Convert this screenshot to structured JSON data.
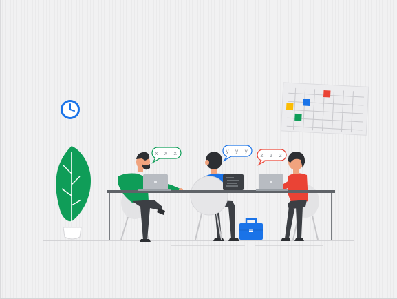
{
  "scene": {
    "description_label": "",
    "palette": {
      "background": "#efeff0",
      "table": "#5f6368",
      "green": "#0f9d58",
      "blue": "#1a73e8",
      "red": "#ea4335",
      "yellow": "#fbbc04",
      "chair": "#e6e6e8",
      "laptop": "#b8bcc2",
      "skin": "#f0a37e"
    },
    "icons": [
      "wall-clock-icon",
      "calendar-board",
      "potted-plant",
      "briefcase-icon"
    ],
    "speech_bubbles": [
      {
        "id": "left",
        "text": "x x x",
        "color": "#0f9d58"
      },
      {
        "id": "middle",
        "text": "y y y",
        "color": "#1a73e8"
      },
      {
        "id": "right",
        "text": "z z z",
        "color": "#ea4335"
      }
    ]
  }
}
